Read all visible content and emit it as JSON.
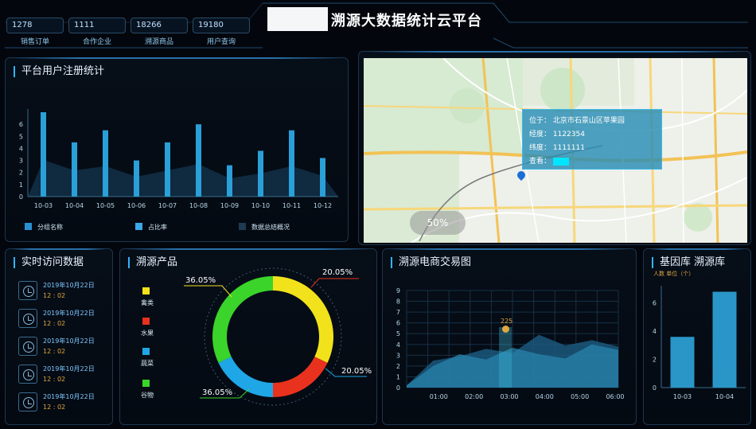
{
  "header": {
    "title": "溯源大数据统计云平台",
    "stats": [
      {
        "value": "1278",
        "label": "销售订单"
      },
      {
        "value": "1111",
        "label": "合作企业"
      },
      {
        "value": "18266",
        "label": "溯源商品"
      },
      {
        "value": "19180",
        "label": "用户查询"
      }
    ]
  },
  "registration": {
    "title": "平台用户注册统计",
    "legend": [
      {
        "label": "分组名称",
        "color": "#2a8fd0"
      },
      {
        "label": "占比率",
        "color": "#3aa9e6"
      },
      {
        "label": "数据总结概况",
        "color": "#1d3b52"
      }
    ],
    "chart_data": {
      "type": "bar",
      "categories": [
        "10-03",
        "10-04",
        "10-05",
        "10-06",
        "10-07",
        "10-08",
        "10-09",
        "10-10",
        "10-11",
        "10-12"
      ],
      "values": [
        7,
        4.5,
        5.5,
        3,
        4.5,
        6,
        2.6,
        3.8,
        5.5,
        3.2
      ],
      "ylim": [
        0,
        7
      ],
      "yticks": [
        "0",
        "1",
        "2",
        "3",
        "4",
        "5",
        "6"
      ]
    }
  },
  "map": {
    "info": {
      "location": "位于：  北京市石景山区苹果园",
      "longitude": "经度：  1122354",
      "latitude": "纬度：  1111111",
      "view": "查看："
    },
    "badge": "50%"
  },
  "visits": {
    "title": "实时访问数据",
    "items": [
      {
        "date": "2019年10月22日",
        "time": "12 : 02"
      },
      {
        "date": "2019年10月22日",
        "time": "12 : 02"
      },
      {
        "date": "2019年10月22日",
        "time": "12 : 02"
      },
      {
        "date": "2019年10月22日",
        "time": "12 : 02"
      },
      {
        "date": "2019年10月22日",
        "time": "12 : 02"
      }
    ]
  },
  "products": {
    "title": "溯源产品",
    "legend": [
      {
        "label": "禽类",
        "color": "#f2e21b"
      },
      {
        "label": "水果",
        "color": "#e8321e"
      },
      {
        "label": "蔬菜",
        "color": "#1fa6e6"
      },
      {
        "label": "谷物",
        "color": "#3ad42a"
      }
    ],
    "chart_data": {
      "type": "pie",
      "labels": [
        "禽类",
        "水果",
        "蔬菜",
        "谷物"
      ],
      "values": [
        36.05,
        20.05,
        20.05,
        36.05
      ],
      "value_labels": [
        "36.05%",
        "20.05%",
        "20.05%",
        "36.05%"
      ],
      "colors": [
        "#f2e21b",
        "#e8321e",
        "#1fa6e6",
        "#3ad42a"
      ]
    }
  },
  "trade": {
    "title": "溯源电商交易图",
    "marker": "225",
    "chart_data": {
      "type": "area",
      "x": [
        "01:00",
        "02:00",
        "03:00",
        "04:00",
        "05:00",
        "06:00"
      ],
      "series": [
        {
          "values": [
            0.2,
            2.5,
            2.9,
            3.6,
            3.2,
            4.9,
            3.9,
            4.4,
            3.8
          ]
        },
        {
          "values": [
            0.2,
            2.0,
            3.1,
            2.6,
            3.7,
            3.1,
            2.7,
            4.0,
            3.5
          ]
        }
      ],
      "ylim": [
        0,
        9
      ],
      "yticks": [
        "0",
        "1",
        "2",
        "3",
        "4",
        "5",
        "6",
        "7",
        "8",
        "9"
      ]
    }
  },
  "gene": {
    "title": "基因库  溯源库",
    "subtitle": "人数 单位（个）",
    "chart_data": {
      "type": "bar",
      "categories": [
        "10-03",
        "10-04"
      ],
      "values": [
        3.6,
        6.8
      ],
      "ylim": [
        0,
        7
      ],
      "yticks": [
        "0",
        "2",
        "4",
        "6"
      ]
    }
  }
}
